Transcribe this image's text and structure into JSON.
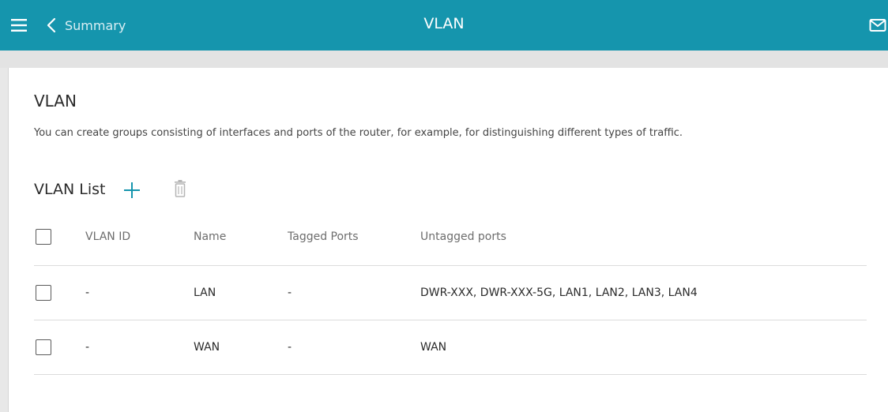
{
  "colors": {
    "header_bg": "#1595ad",
    "accent": "#1595ad",
    "icon_muted": "#b5b5b5"
  },
  "header": {
    "menu_icon": "hamburger-menu-icon",
    "back_icon": "chevron-left-icon",
    "back_label": "Summary",
    "title": "VLAN",
    "mail_icon": "mail-icon"
  },
  "section": {
    "title": "VLAN",
    "description": "You can create groups consisting of interfaces and ports of the router, for example, for distinguishing different types of traffic."
  },
  "vlan_list": {
    "title": "VLAN List",
    "add_icon": "plus-icon",
    "delete_icon": "trash-icon",
    "columns": [
      "VLAN ID",
      "Name",
      "Tagged Ports",
      "Untagged ports"
    ],
    "rows": [
      {
        "vlan_id": "-",
        "name": "LAN",
        "tagged": "-",
        "untagged": "DWR-XXX, DWR-XXX-5G, LAN1, LAN2, LAN3, LAN4",
        "checked": false
      },
      {
        "vlan_id": "-",
        "name": "WAN",
        "tagged": "-",
        "untagged": "WAN",
        "checked": false
      }
    ]
  }
}
